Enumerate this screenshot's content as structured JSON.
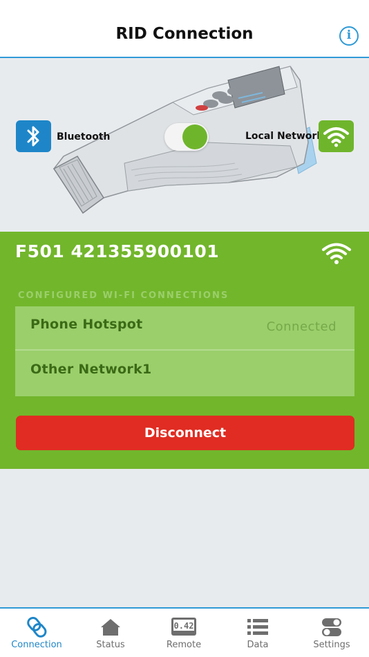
{
  "header": {
    "title": "RID Connection",
    "info_icon": "info-icon",
    "info_glyph": "i"
  },
  "hero": {
    "bluetooth_label": "Bluetooth",
    "local_network_label": "Local Network",
    "connection_mode_toggle": "local-network",
    "bluetooth_icon": "bluetooth-icon",
    "wifi_icon": "wifi-icon",
    "device_screen_reading": "",
    "colors": {
      "bluetooth": "#1e86c8",
      "local_network": "#6fb52c"
    }
  },
  "device": {
    "name": "F501 421355900101",
    "status_icon": "wifi-icon"
  },
  "networks": {
    "section_title": "CONFIGURED WI-FI CONNECTIONS",
    "items": [
      {
        "name": "Phone Hotspot",
        "status": "Connected"
      },
      {
        "name": "Other Network1",
        "status": ""
      }
    ]
  },
  "actions": {
    "disconnect_label": "Disconnect",
    "disconnect_color": "#e02c22"
  },
  "tabs": [
    {
      "label": "Connection",
      "icon": "link-icon",
      "active": true
    },
    {
      "label": "Status",
      "icon": "home-icon",
      "active": false
    },
    {
      "label": "Remote",
      "icon": "remote-display-icon",
      "active": false,
      "icon_text": "0.42"
    },
    {
      "label": "Data",
      "icon": "list-icon",
      "active": false
    },
    {
      "label": "Settings",
      "icon": "toggles-icon",
      "active": false
    }
  ],
  "colors": {
    "accent": "#2f9ad6",
    "panel_green": "#72b62c",
    "list_green": "#9bcf6b"
  }
}
